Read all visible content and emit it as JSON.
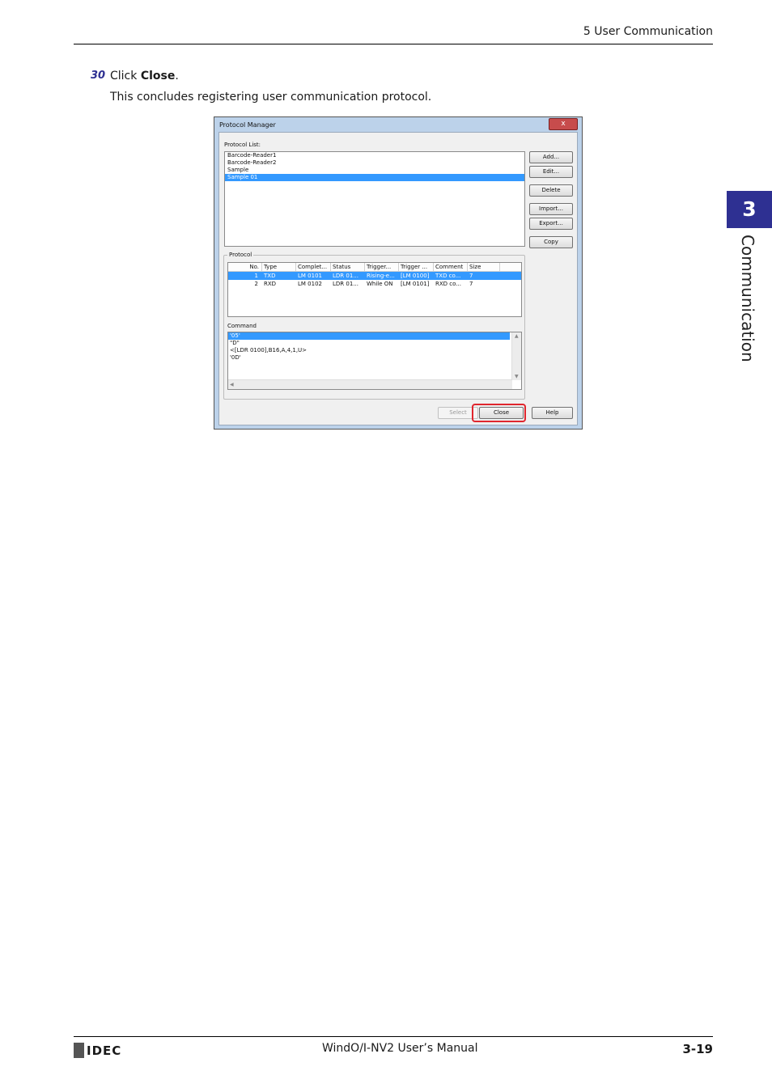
{
  "header": {
    "section_title": "5 User Communication"
  },
  "side_tab": {
    "number": "3",
    "label": "Communication"
  },
  "step": {
    "number": "30",
    "text_before": "Click ",
    "bold": "Close",
    "text_after": ".",
    "description": "This concludes registering user communication protocol."
  },
  "dialog": {
    "title": "Protocol Manager",
    "close_glyph": "x",
    "protocol_list_label": "Protocol List:",
    "protocol_list": [
      "Barcode-Reader1",
      "Barcode-Reader2",
      "Sample",
      "Sample 01"
    ],
    "buttons": {
      "add": "Add...",
      "edit": "Edit...",
      "delete": "Delete",
      "import": "Import...",
      "export": "Export...",
      "copy": "Copy",
      "select": "Select",
      "close": "Close",
      "help": "Help"
    },
    "protocol_group_label": "Protocol",
    "table_columns": [
      "No.",
      "Type",
      "Complet...",
      "Status",
      "Trigger...",
      "Trigger ...",
      "Comment",
      "Size"
    ],
    "table_rows": [
      [
        "1",
        "TXD",
        "LM 0101",
        "LDR 01...",
        "Rising-e...",
        "[LM 0100]",
        "TXD co...",
        "7"
      ],
      [
        "2",
        "RXD",
        "LM 0102",
        "LDR 01...",
        "While ON",
        "[LM 0101]",
        "RXD co...",
        "7"
      ]
    ],
    "command_label": "Command",
    "command_lines": [
      "'05'",
      "\"D\"",
      "<[LDR 0100],B16,A,4,1,U>",
      "'0D'"
    ]
  },
  "footer": {
    "brand": "IDEC",
    "manual": "WindO/I-NV2 User’s Manual",
    "page": "3-19"
  }
}
